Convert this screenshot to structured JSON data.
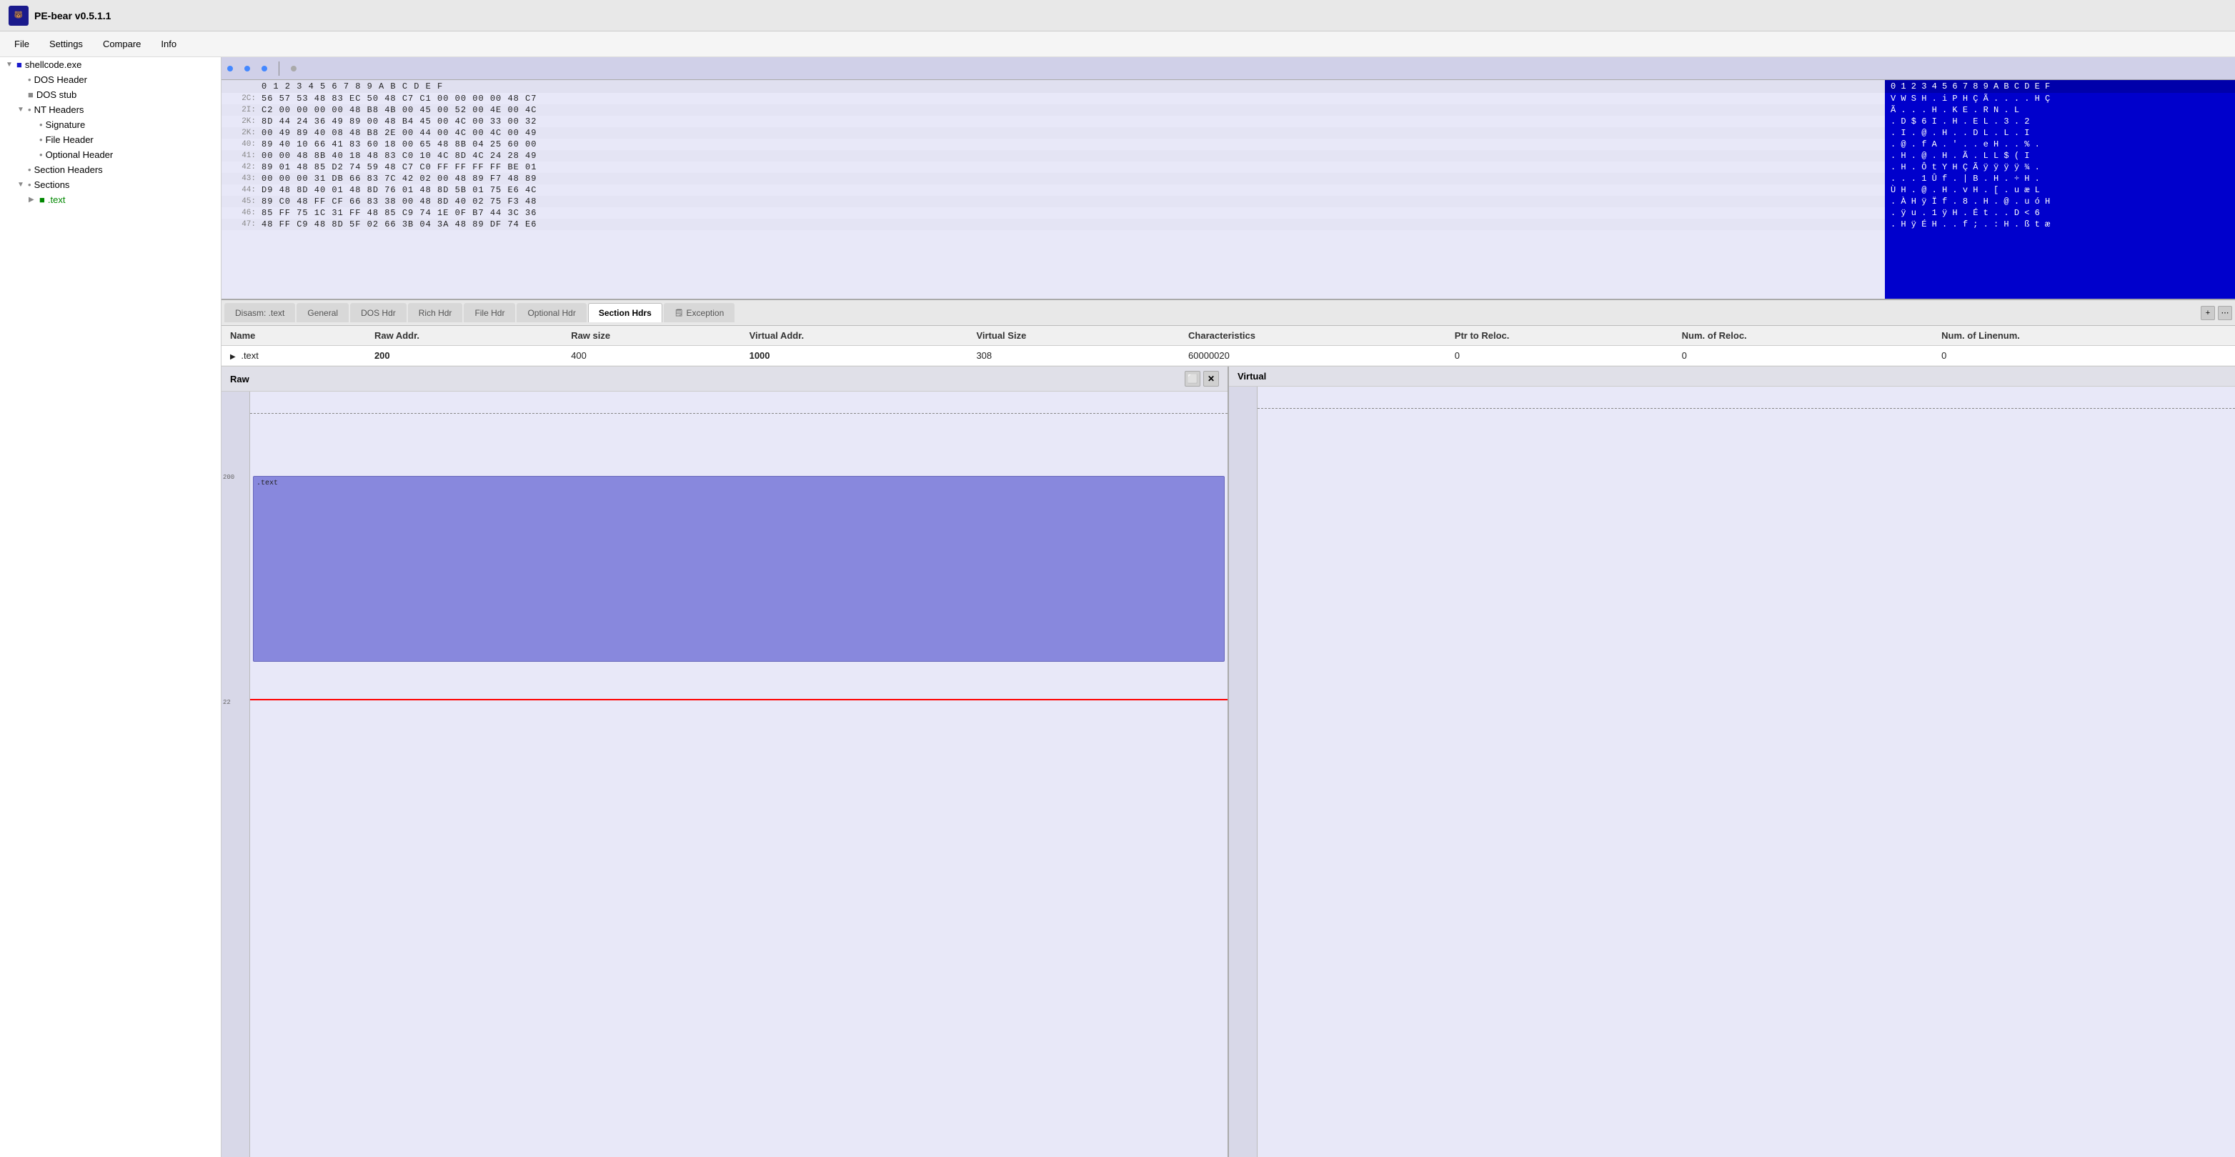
{
  "app": {
    "title": "PE-bear v0.5.1.1",
    "icon": "PE"
  },
  "menu": {
    "items": [
      "File",
      "Settings",
      "Compare",
      "Info"
    ]
  },
  "sidebar": {
    "tree": [
      {
        "id": "shellcode",
        "label": "shellcode.exe",
        "indent": 0,
        "type": "root",
        "expanded": true
      },
      {
        "id": "dos-header",
        "label": "DOS Header",
        "indent": 1,
        "type": "leaf"
      },
      {
        "id": "dos-stub",
        "label": "DOS stub",
        "indent": 1,
        "type": "leaf"
      },
      {
        "id": "nt-headers",
        "label": "NT Headers",
        "indent": 1,
        "type": "branch",
        "expanded": true
      },
      {
        "id": "signature",
        "label": "Signature",
        "indent": 2,
        "type": "leaf"
      },
      {
        "id": "file-header",
        "label": "File Header",
        "indent": 2,
        "type": "leaf"
      },
      {
        "id": "optional-header",
        "label": "Optional Header",
        "indent": 2,
        "type": "leaf"
      },
      {
        "id": "section-headers",
        "label": "Section Headers",
        "indent": 1,
        "type": "leaf"
      },
      {
        "id": "sections",
        "label": "Sections",
        "indent": 1,
        "type": "branch",
        "expanded": true
      },
      {
        "id": "text-section",
        "label": ".text",
        "indent": 2,
        "type": "leaf",
        "color": "green"
      }
    ]
  },
  "hex_view": {
    "col_headers": "0 1 2 3 4 5 6 7 8 9 A B C D E F",
    "rows": [
      {
        "addr": "2C:",
        "bytes": "56 57 53 48 83 EC 50 48 C7 C1 00 00 00 00 48 C7"
      },
      {
        "addr": "2I:",
        "bytes": "C2 00 00 00 00 48 B8 4B 00 45 00 52 00 4E 00 4C"
      },
      {
        "addr": "2K:",
        "bytes": "8D 44 24 36 49 89 00 48 B4 45 00 4C 00 33 00 32"
      },
      {
        "addr": "2K:",
        "bytes": "00 49 89 40 08 48 B8 2E 00 44 00 4C 00 4C 00 49"
      },
      {
        "addr": "40:",
        "bytes": "89 40 10 66 41 83 60 18 00 65 48 8B 04 25 60 00"
      },
      {
        "addr": "41:",
        "bytes": "00 00 48 8B 40 18 48 83 C0 10 4C 8D 4C 24 28 49"
      },
      {
        "addr": "42:",
        "bytes": "89 01 48 85 D2 74 59 48 C7 C0 FF FF FF FF BE 01"
      },
      {
        "addr": "43:",
        "bytes": "00 00 00 31 DB 66 83 7C 42 02 00 48 89 F7 48 89"
      },
      {
        "addr": "44:",
        "bytes": "D9 48 8D 40 01 48 8D 76 01 48 8D 5B 01 75 E6 4C"
      },
      {
        "addr": "45:",
        "bytes": "89 C0 48 FF CF 66 83 38 00 48 8D 40 02 75 F3 48"
      },
      {
        "addr": "46:",
        "bytes": "85 FF 75 1C 31 FF 48 85 C9 74 1E 0F B7 44 3C 36"
      },
      {
        "addr": "47:",
        "bytes": "48 FF C9 48 8D 5F 02 66 3B 04 3A 48 89 DF 74 E6"
      }
    ],
    "ascii_col_headers": "0 1 2 3 4 5 6 7 8 9 A B C D E F",
    "ascii_rows": [
      "V W S H . i P H Ç Ã . . . . H Ç",
      "Ã . . . H . K E . R N . L",
      ". D $ 6 I . H . E L . 3 . 2",
      ". I . @ . H . . D L . L . I",
      ". @ . f A . ' . . e H . . % .",
      ". H . @ . H . Ã . L L $ ( I",
      ". H . Ô t Y H Ç Ã ÿ ÿ ÿ ÿ ¾ .",
      ". . . 1 Û f . | B . H . ÷ H .",
      "Ù H . @ . H . v H . [ . u æ L",
      ". À H ÿ Ï f . 8 . H . @ . u ó H",
      ". ÿ u . 1 ÿ H . É t . . D < 6",
      ". H ÿ É H . . f ; . : H . ß t æ"
    ]
  },
  "tabs": {
    "items": [
      {
        "id": "disasm-text",
        "label": "Disasm: .text",
        "active": false
      },
      {
        "id": "general",
        "label": "General",
        "active": false
      },
      {
        "id": "dos-hdr",
        "label": "DOS Hdr",
        "active": false
      },
      {
        "id": "rich-hdr",
        "label": "Rich Hdr",
        "active": false
      },
      {
        "id": "file-hdr",
        "label": "File Hdr",
        "active": false
      },
      {
        "id": "optional-hdr",
        "label": "Optional Hdr",
        "active": false
      },
      {
        "id": "section-hdrs",
        "label": "Section Hdrs",
        "active": true
      },
      {
        "id": "exception",
        "label": "Exception",
        "active": false
      }
    ],
    "action_plus": "+",
    "action_dots": "⋯"
  },
  "section_table": {
    "columns": [
      "Name",
      "Raw Addr.",
      "Raw size",
      "Virtual Addr.",
      "Virtual Size",
      "Characteristics",
      "Ptr to Reloc.",
      "Num. of Reloc.",
      "Num. of Linenum."
    ],
    "rows": [
      {
        "expand": "▶",
        "name": ".text",
        "raw_addr": "200",
        "raw_size": "400",
        "virtual_addr": "1000",
        "virtual_size": "308",
        "characteristics": "60000020",
        "ptr_to_reloc": "0",
        "num_of_reloc": "0",
        "num_of_linenum": "0"
      }
    ]
  },
  "raw_panel": {
    "title": "Raw",
    "ruler_marks": [
      "200",
      "22"
    ],
    "section_label": ".text"
  },
  "virtual_panel": {
    "title": "Virtual"
  },
  "colors": {
    "hex_bg": "#e8e8f8",
    "hex_ascii_bg": "#0000cc",
    "sidebar_bg": "#ffffff",
    "tab_active_bg": "#ffffff",
    "section_block": "#8888dd",
    "map_ruler_bg": "#d8d8e8"
  }
}
